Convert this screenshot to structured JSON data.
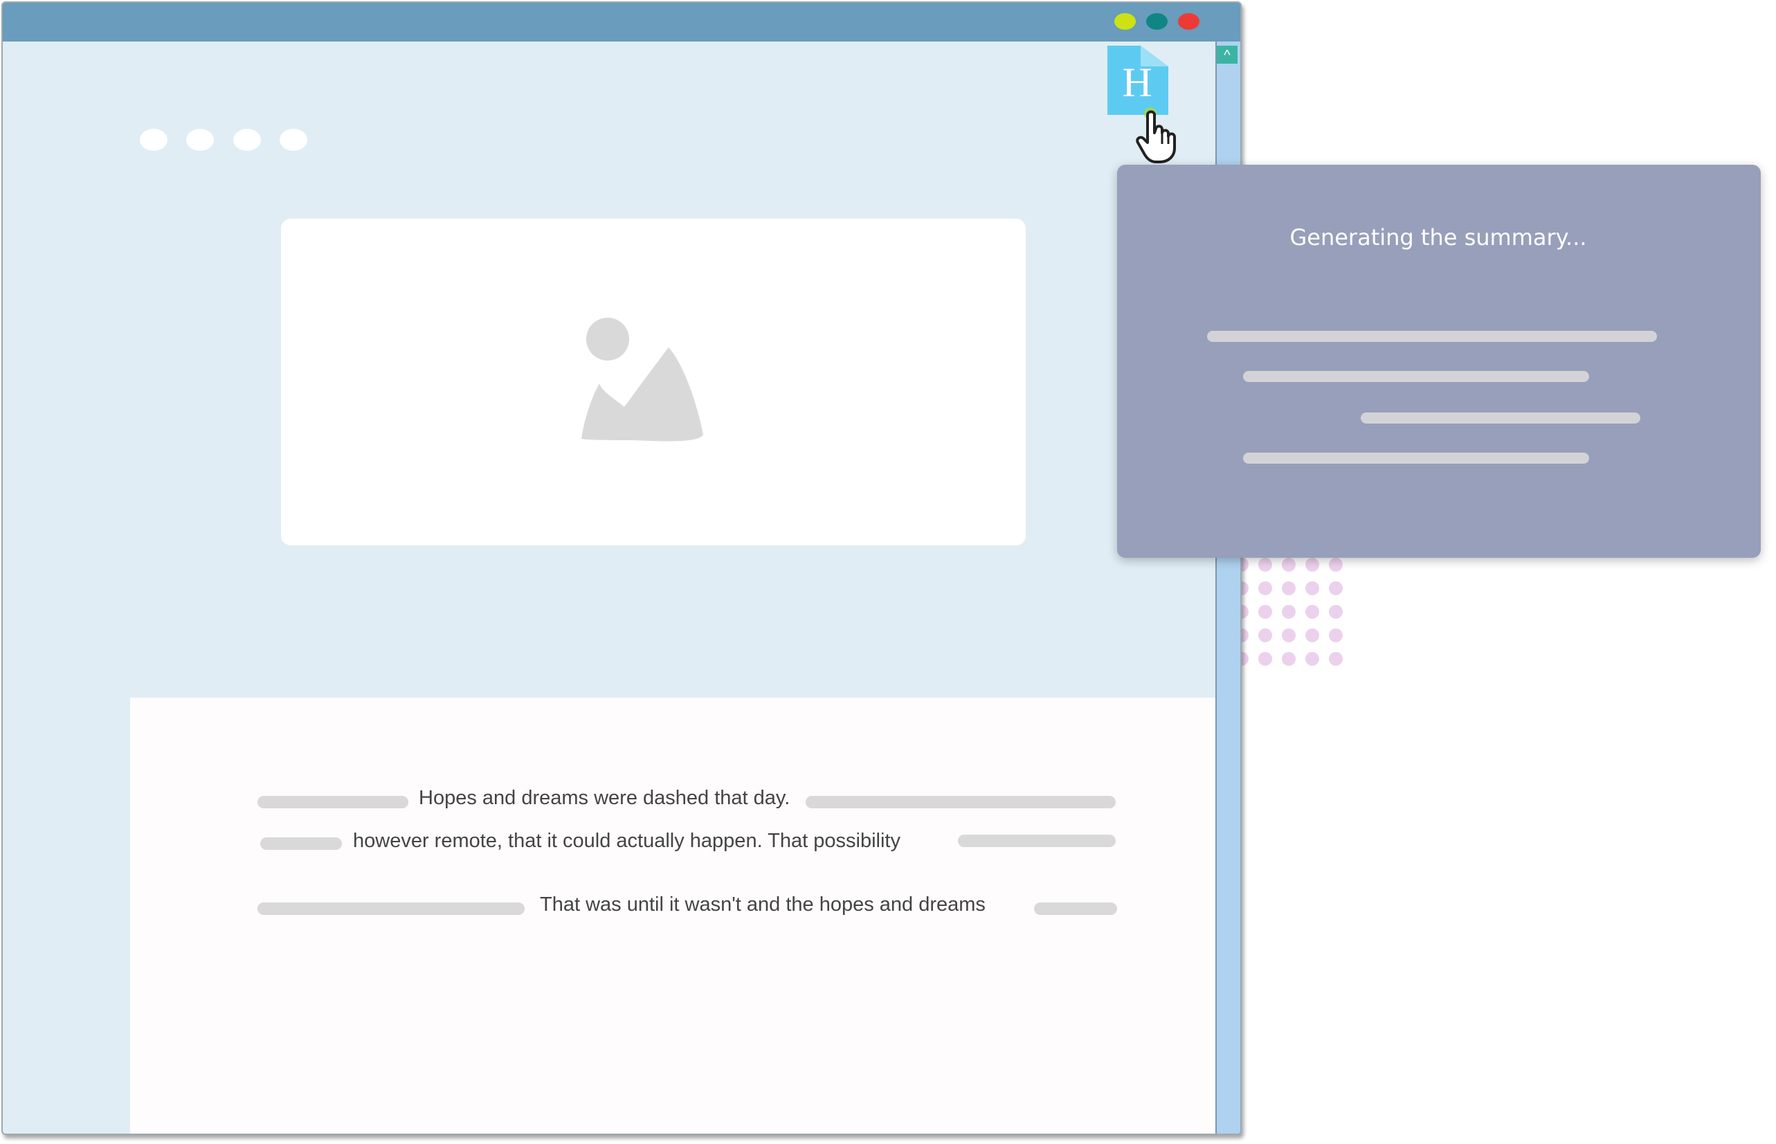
{
  "window": {
    "controls": [
      "minimize-button",
      "maximize-button",
      "close-button"
    ],
    "scroll_up_glyph": "^"
  },
  "extension": {
    "letter": "H",
    "icon": "page-h-icon",
    "cursor": "hand-pointer-icon"
  },
  "hero": {
    "icon": "image-placeholder-icon"
  },
  "article": {
    "lines": [
      "Hopes and dreams were dashed that day.",
      "however remote, that it could actually happen. That possibility",
      "That was until it wasn't and the hopes and dreams"
    ]
  },
  "summary": {
    "title": "Generating the summary..."
  },
  "colors": {
    "titlebar": "#699cbd",
    "page_background": "#e0edf5",
    "popup": "#979fbb",
    "extension_icon": "#5dcbf1",
    "minimize": "#cde213",
    "maximize": "#0f8685",
    "close": "#ee3a36",
    "decor_dots": "#ecd1ec"
  }
}
